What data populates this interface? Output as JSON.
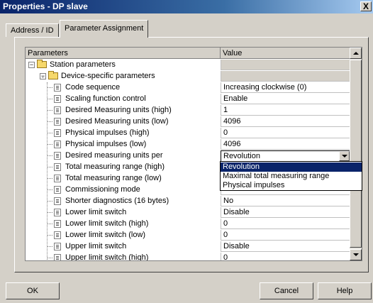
{
  "window": {
    "title": "Properties - DP slave",
    "close_label": "X"
  },
  "tabs": [
    {
      "label": "Address / ID",
      "active": false
    },
    {
      "label": "Parameter Assignment",
      "active": true
    }
  ],
  "grid": {
    "columns": [
      "Parameters",
      "Value"
    ],
    "rows": [
      {
        "label": "Station parameters",
        "value": "",
        "kind": "folder"
      },
      {
        "label": "Device-specific parameters",
        "value": "",
        "kind": "folder"
      },
      {
        "label": "Code sequence",
        "value": "Increasing clockwise (0)",
        "kind": "param"
      },
      {
        "label": "Scaling function control",
        "value": "Enable",
        "kind": "param"
      },
      {
        "label": "Desired Measuring units (high)",
        "value": "1",
        "kind": "param"
      },
      {
        "label": "Desired Measuring units (low)",
        "value": "4096",
        "kind": "param"
      },
      {
        "label": "Physical impulses (high)",
        "value": "0",
        "kind": "param"
      },
      {
        "label": "Physical impulses (low)",
        "value": "4096",
        "kind": "param"
      },
      {
        "label": "Desired measuring units per",
        "value": "Revolution",
        "kind": "combo"
      },
      {
        "label": "Total measuring range (high)",
        "value": "",
        "kind": "param"
      },
      {
        "label": "Total measuring range (low)",
        "value": "",
        "kind": "param"
      },
      {
        "label": "Commissioning mode",
        "value": "",
        "kind": "param"
      },
      {
        "label": "Shorter diagnostics (16 bytes)",
        "value": "No",
        "kind": "param"
      },
      {
        "label": "Lower limit switch",
        "value": "Disable",
        "kind": "param"
      },
      {
        "label": "Lower limit switch (high)",
        "value": "0",
        "kind": "param"
      },
      {
        "label": "Lower limit switch (low)",
        "value": "0",
        "kind": "param"
      },
      {
        "label": "Upper limit switch",
        "value": "Disable",
        "kind": "param"
      },
      {
        "label": "Upper limit switch (high)",
        "value": "0",
        "kind": "param"
      }
    ]
  },
  "dropdown": {
    "options": [
      "Revolution",
      "Maximal total measuring range",
      "Physical impulses"
    ],
    "selected": "Revolution"
  },
  "buttons": {
    "ok": "OK",
    "cancel": "Cancel",
    "help": "Help"
  },
  "colors": {
    "selection": "#0a246a",
    "face": "#d4d0c8"
  }
}
